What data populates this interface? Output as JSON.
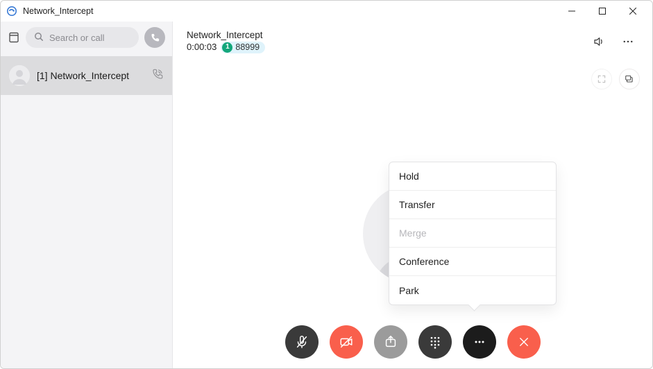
{
  "window": {
    "title": "Network_Intercept"
  },
  "sidebar": {
    "search_placeholder": "Search or call",
    "items": [
      {
        "label": "[1] Network_Intercept"
      }
    ]
  },
  "call": {
    "name": "Network_Intercept",
    "duration": "0:00:03",
    "badge_count": "1",
    "badge_number": "88999"
  },
  "menu": {
    "hold": "Hold",
    "transfer": "Transfer",
    "merge": "Merge",
    "conference": "Conference",
    "park": "Park"
  },
  "controls": {
    "mute": "mute",
    "video_off": "video-off",
    "share": "share",
    "dialpad": "dialpad",
    "more": "more",
    "hangup": "hangup"
  }
}
